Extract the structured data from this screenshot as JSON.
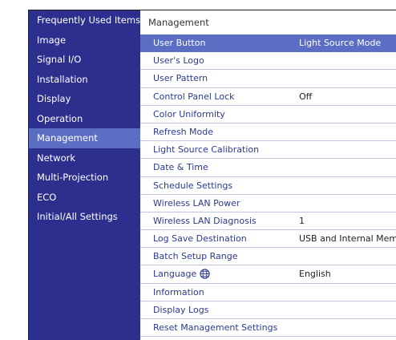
{
  "sidebar": {
    "items": [
      {
        "label": "Frequently Used Items",
        "active": false
      },
      {
        "label": "Image",
        "active": false
      },
      {
        "label": "Signal I/O",
        "active": false
      },
      {
        "label": "Installation",
        "active": false
      },
      {
        "label": "Display",
        "active": false
      },
      {
        "label": "Operation",
        "active": false
      },
      {
        "label": "Management",
        "active": true
      },
      {
        "label": "Network",
        "active": false
      },
      {
        "label": "Multi-Projection",
        "active": false
      },
      {
        "label": "ECO",
        "active": false
      },
      {
        "label": "Initial/All Settings",
        "active": false
      }
    ]
  },
  "main": {
    "header": "Management",
    "rows": [
      {
        "label": "User Button",
        "value": "Light Source Mode",
        "active": true
      },
      {
        "label": "User's Logo",
        "value": ""
      },
      {
        "label": "User Pattern",
        "value": ""
      },
      {
        "label": "Control Panel Lock",
        "value": "Off"
      },
      {
        "label": "Color Uniformity",
        "value": ""
      },
      {
        "label": "Refresh Mode",
        "value": ""
      },
      {
        "label": "Light Source Calibration",
        "value": ""
      },
      {
        "label": "Date & Time",
        "value": ""
      },
      {
        "label": "Schedule Settings",
        "value": ""
      },
      {
        "label": "Wireless LAN Power",
        "value": ""
      },
      {
        "label": "Wireless LAN Diagnosis",
        "value": "1"
      },
      {
        "label": "Log Save Destination",
        "value": "USB and Internal Memo"
      },
      {
        "label": "Batch Setup Range",
        "value": ""
      },
      {
        "label": "Language",
        "value": "English",
        "icon": "globe-icon"
      },
      {
        "label": "Information",
        "value": ""
      },
      {
        "label": "Display Logs",
        "value": ""
      },
      {
        "label": "Reset Management Settings",
        "value": ""
      }
    ]
  },
  "colors": {
    "sidebar_bg": "#2c2f8e",
    "highlight": "#5b6ec4",
    "label_text": "#2b3a8f",
    "divider": "#bfc6de"
  }
}
